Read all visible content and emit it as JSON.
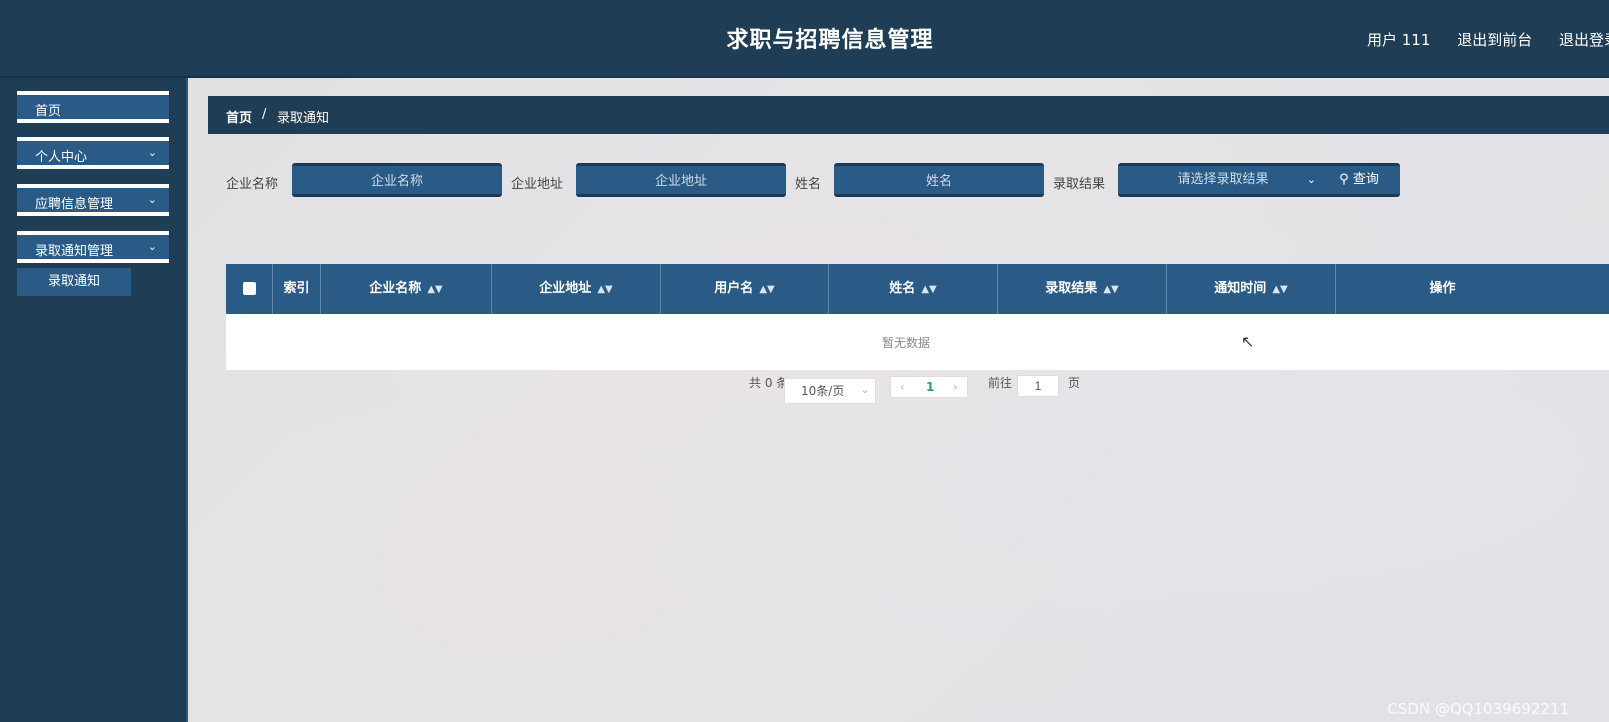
{
  "header": {
    "title": "求职与招聘信息管理",
    "links": [
      "用户 111",
      "退出到前台",
      "退出登录"
    ]
  },
  "sidebar": {
    "items": [
      {
        "label": "首页",
        "expandable": false
      },
      {
        "label": "个人中心",
        "expandable": true
      },
      {
        "label": "应聘信息管理",
        "expandable": true
      },
      {
        "label": "录取通知管理",
        "expandable": true
      }
    ],
    "sub_items": [
      "录取通知"
    ]
  },
  "breadcrumb": {
    "home": "首页",
    "separator": "/",
    "current": "录取通知"
  },
  "search": {
    "company_name_label": "企业名称",
    "company_name_placeholder": "企业名称",
    "company_address_label": "企业地址",
    "company_address_placeholder": "企业地址",
    "name_label": "姓名",
    "name_placeholder": "姓名",
    "result_label": "录取结果",
    "result_placeholder": "请选择录取结果",
    "query_button": "查询"
  },
  "table": {
    "columns": [
      "索引",
      "企业名称",
      "企业地址",
      "用户名",
      "姓名",
      "录取结果",
      "通知时间",
      "操作"
    ],
    "empty_text": "暂无数据"
  },
  "pagination": {
    "total_text": "共 0 条",
    "page_size": "10条/页",
    "current_page": "1",
    "goto_label": "前往",
    "goto_value": "1",
    "page_suffix": "页"
  },
  "watermark": "CSDN @QQ1039692211",
  "colors": {
    "header_bg": "#1f3d55",
    "accent": "#2a5b86",
    "page_active": "#2a9d6f"
  }
}
